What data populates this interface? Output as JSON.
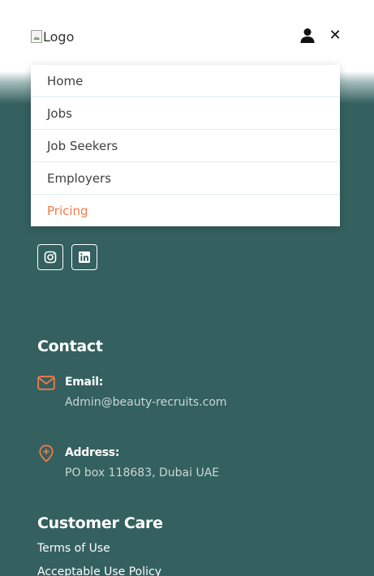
{
  "header": {
    "logo_alt": "Logo"
  },
  "menu": {
    "items": [
      {
        "label": "Home"
      },
      {
        "label": "Jobs"
      },
      {
        "label": "Job Seekers"
      },
      {
        "label": "Employers"
      },
      {
        "label": "Pricing"
      }
    ],
    "active_index": 4
  },
  "footer": {
    "contact": {
      "title": "Contact",
      "email_label": "Email:",
      "email_value": "Admin@beauty-recruits.com",
      "address_label": "Address:",
      "address_value": "PO box 118683, Dubai UAE"
    },
    "customer_care": {
      "title": "Customer Care",
      "links": [
        {
          "label": "Terms of Use"
        },
        {
          "label": "Acceptable Use Policy"
        }
      ]
    }
  },
  "colors": {
    "footer_bg": "#34605f",
    "accent": "#f07a4a",
    "menu_divider": "#dfeef5"
  }
}
